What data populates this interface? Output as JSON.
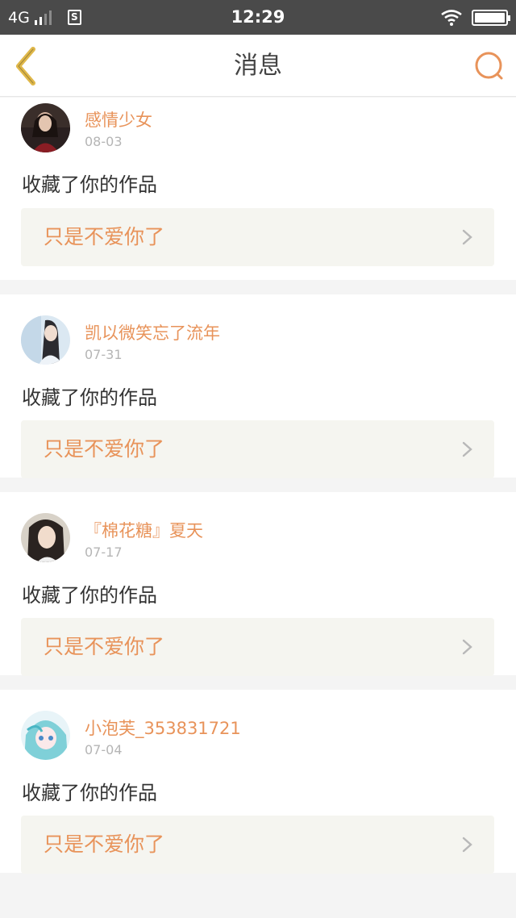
{
  "status_bar": {
    "network": "4G",
    "app_icon": "S",
    "time": "12:29"
  },
  "header": {
    "title": "消息"
  },
  "messages": [
    {
      "username": "感情少女",
      "date": "08-03",
      "action": "收藏了你的作品",
      "work_title": "只是不爱你了"
    },
    {
      "username": "凯以微笑忘了流年",
      "date": "07-31",
      "action": "收藏了你的作品",
      "work_title": "只是不爱你了"
    },
    {
      "username": "『棉花糖』夏天",
      "date": "07-17",
      "action": "收藏了你的作品",
      "work_title": "只是不爱你了"
    },
    {
      "username": "小泡芙_353831721",
      "date": "07-04",
      "action": "收藏了你的作品",
      "work_title": "只是不爱你了"
    }
  ],
  "icons": {
    "back": "chevron-left-icon",
    "search": "search-icon",
    "row_arrow": "chevron-right-icon"
  },
  "colors": {
    "accent": "#e8935a",
    "back_arrow": "#e0b84a",
    "status_bar": "#4a4a4a"
  }
}
